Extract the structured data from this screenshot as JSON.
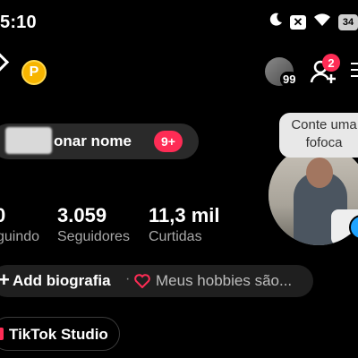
{
  "status_bar": {
    "time": "5:10",
    "battery": "34"
  },
  "header": {
    "coin_letter": "P",
    "friend_count": "99",
    "notification_count": "2"
  },
  "profile": {
    "name_text": "onar nome",
    "name_badge": "9+",
    "note": "Conte uma fofoca"
  },
  "stats": [
    {
      "value": "0",
      "label": "guindo"
    },
    {
      "value": "3.059",
      "label": "Seguidores"
    },
    {
      "value": "11,3 mil",
      "label": "Curtidas"
    }
  ],
  "bio": {
    "plus": "+",
    "add_label": "Add biografia",
    "separator": "·",
    "hobbies": "Meus hobbies são..."
  },
  "studio": {
    "label": "TikTok Studio"
  },
  "colors": {
    "accent": "#fe2c55",
    "coin": "#f7b500",
    "background": "#000000"
  }
}
